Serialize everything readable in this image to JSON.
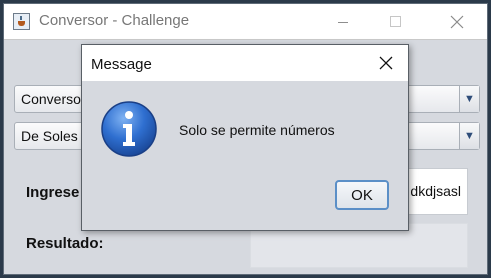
{
  "main_window": {
    "title": "Conversor - Challenge",
    "combo_conversion": "Conversor",
    "combo_type": "De Soles",
    "ingrese_label": "Ingrese",
    "input_value": "dkdjsasl",
    "resultado_label": "Resultado:",
    "result_value": ""
  },
  "dialog": {
    "title": "Message",
    "message": "Solo se permite números",
    "ok_label": "OK"
  },
  "colors": {
    "info_icon_blue": "#2f6fd0",
    "ok_focus_border": "#5b8fc7"
  },
  "icons": {
    "app": "java-cup-icon",
    "info": "info-icon",
    "close": "close-icon",
    "dropdown": "chevron-down-icon"
  }
}
